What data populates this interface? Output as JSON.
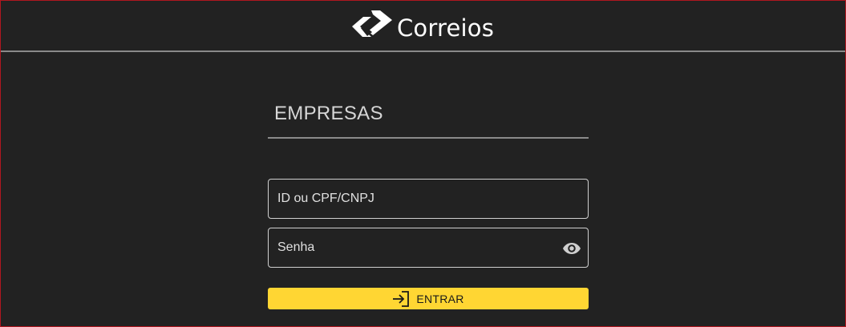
{
  "header": {
    "logo_text": "Correios",
    "logo_icon": "correios-logo-mark"
  },
  "main": {
    "title": "EMPRESAS"
  },
  "form": {
    "id_field": {
      "placeholder": "ID ou CPF/CNPJ",
      "value": ""
    },
    "password_field": {
      "placeholder": "Senha",
      "value": "",
      "toggle_icon": "eye-icon"
    },
    "submit": {
      "label": "ENTRAR",
      "icon": "login-icon"
    }
  },
  "colors": {
    "background": "#222222",
    "accent": "#ffd633",
    "divider": "#8a8a8a",
    "frame_border": "#b0171f"
  }
}
